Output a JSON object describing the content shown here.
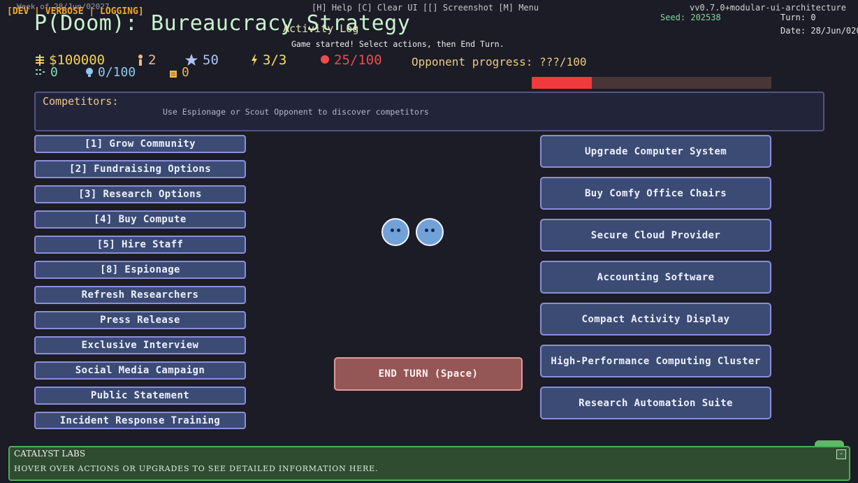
{
  "header": {
    "dev_banner": "[DEV | VERBOSE | LOGGING]",
    "week_label": "Week of 28/Jun/02027",
    "help_bar": "[H] Help  [C] Clear UI  [[] Screenshot  [M] Menu",
    "title": "P(Doom): Bureaucracy Strategy",
    "version": "vv0.7.0+modular-ui-architecture",
    "seed": "Seed: 202538",
    "turn": "Turn: 0",
    "date": "Date: 28/Jun/020"
  },
  "activity_log": {
    "title": "Activity Log",
    "lines": [
      "Game started! Select actions, then End Turn."
    ]
  },
  "resources": {
    "money": "$100000",
    "staff": "2",
    "reputation": "50",
    "action_points": "3/3",
    "doom": "25/100",
    "compute": "0",
    "research": "0/100",
    "papers": "0",
    "opponent_label": "Opponent progress: ???/100",
    "doom_level": 25,
    "doom_max": 100
  },
  "competitors": {
    "title": "Competitors:",
    "hint": "Use Espionage or Scout Opponent to discover competitors"
  },
  "actions": [
    "[1] Grow Community",
    "[2] Fundraising Options",
    "[3] Research Options",
    "[4] Buy Compute",
    "[5] Hire Staff",
    "[8] Espionage",
    "Refresh Researchers",
    "Press Release",
    "Exclusive Interview",
    "Social Media Campaign",
    "Public Statement",
    "Incident Response Training"
  ],
  "upgrades": [
    "Upgrade Computer System",
    "Buy Comfy Office Chairs",
    "Secure Cloud Provider",
    "Accounting Software",
    "Compact Activity Display",
    "High-Performance Computing Cluster",
    "Research Automation Suite"
  ],
  "end_turn": "END TURN (Space)",
  "info_panel": {
    "title": "CATALYST LABS",
    "text": "HOVER OVER ACTIONS OR UPGRADES TO SEE DETAILED INFORMATION HERE.",
    "minimize": "-"
  },
  "colors": {
    "background": "#1b1c25",
    "button_fill": "#3c4b73",
    "button_border": "#8d8ddc",
    "end_turn_fill": "#955656",
    "doom_red": "#f03a3d",
    "panel_green": "#2f4b30"
  },
  "icons": {
    "money": "money-icon",
    "staff": "staff-icon",
    "reputation": "star-icon",
    "action_points": "lightning-icon",
    "doom": "doom-icon",
    "compute": "compute-icon",
    "research": "lightbulb-icon",
    "papers": "paper-icon"
  }
}
